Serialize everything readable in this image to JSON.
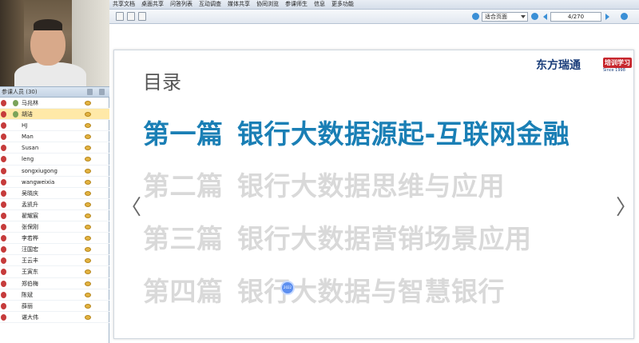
{
  "menu": {
    "items": [
      "共享文档",
      "桌面共享",
      "问答列表",
      "互动调查",
      "媒体共享",
      "协同浏览",
      "参课师生",
      "信息",
      "更多功能"
    ]
  },
  "toolbar": {
    "zoom_select": "适合页面",
    "page_counter": "4/270"
  },
  "members": {
    "header": "参课人员 (30)",
    "list": [
      {
        "name": "马兆林"
      },
      {
        "name": "胡洁",
        "selected": true
      },
      {
        "name": "HJ"
      },
      {
        "name": "Man"
      },
      {
        "name": "Susan"
      },
      {
        "name": "leng"
      },
      {
        "name": "songxiugong"
      },
      {
        "name": "wangweixia"
      },
      {
        "name": "吴晓庆"
      },
      {
        "name": "孟凯升"
      },
      {
        "name": "翟耀宸"
      },
      {
        "name": "张保刚"
      },
      {
        "name": "李若桦"
      },
      {
        "name": "汪国宏"
      },
      {
        "name": "王云丰"
      },
      {
        "name": "王寅东"
      },
      {
        "name": "郑伯梅"
      },
      {
        "name": "陈斌"
      },
      {
        "name": "薛丽"
      },
      {
        "name": "谌大伟"
      }
    ]
  },
  "slide": {
    "title": "目录",
    "logo_text": "东方瑞通",
    "logo_badge": "培训学习",
    "logo_sub": "Since 1998",
    "chapters": [
      {
        "num": "第一篇",
        "text": "银行大数据源起-互联网金融",
        "active": true
      },
      {
        "num": "第二篇",
        "text": "银行大数据思维与应用",
        "active": false
      },
      {
        "num": "第三篇",
        "text": "银行大数据营销场景应用",
        "active": false
      },
      {
        "num": "第四篇",
        "text": "银行大数据与智慧银行",
        "active": false
      }
    ],
    "left_arrow": "〈",
    "right_arrow": "〉",
    "cursor_label": "2022"
  }
}
